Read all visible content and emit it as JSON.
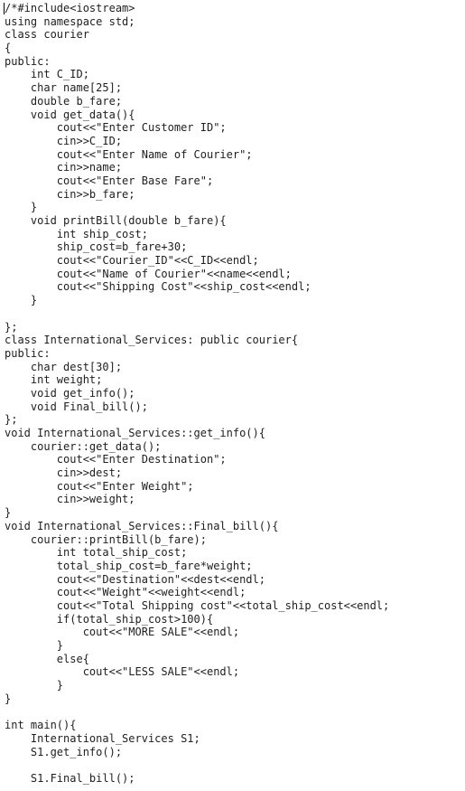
{
  "editor": {
    "code_lines": [
      "/*#include<iostream>",
      "using namespace std;",
      "class courier",
      "{",
      "public:",
      "    int C_ID;",
      "    char name[25];",
      "    double b_fare;",
      "    void get_data(){",
      "        cout<<\"Enter Customer ID\";",
      "        cin>>C_ID;",
      "        cout<<\"Enter Name of Courier\";",
      "        cin>>name;",
      "        cout<<\"Enter Base Fare\";",
      "        cin>>b_fare;",
      "    }",
      "    void printBill(double b_fare){",
      "        int ship_cost;",
      "        ship_cost=b_fare+30;",
      "        cout<<\"Courier_ID\"<<C_ID<<endl;",
      "        cout<<\"Name of Courier\"<<name<<endl;",
      "        cout<<\"Shipping Cost\"<<ship_cost<<endl;",
      "    }",
      "",
      "};",
      "class International_Services: public courier{",
      "public:",
      "    char dest[30];",
      "    int weight;",
      "    void get_info();",
      "    void Final_bill();",
      "};",
      "void International_Services::get_info(){",
      "    courier::get_data();",
      "        cout<<\"Enter Destination\";",
      "        cin>>dest;",
      "        cout<<\"Enter Weight\";",
      "        cin>>weight;",
      "}",
      "void International_Services::Final_bill(){",
      "    courier::printBill(b_fare);",
      "        int total_ship_cost;",
      "        total_ship_cost=b_fare*weight;",
      "        cout<<\"Destination\"<<dest<<endl;",
      "        cout<<\"Weight\"<<weight<<endl;",
      "        cout<<\"Total Shipping cost\"<<total_ship_cost<<endl;",
      "        if(total_ship_cost>100){",
      "            cout<<\"MORE SALE\"<<endl;",
      "        }",
      "        else{",
      "            cout<<\"LESS SALE\"<<endl;",
      "        }",
      "}",
      "",
      "int main(){",
      "    International_Services S1;",
      "    S1.get_info();",
      "",
      "    S1.Final_bill();"
    ]
  }
}
